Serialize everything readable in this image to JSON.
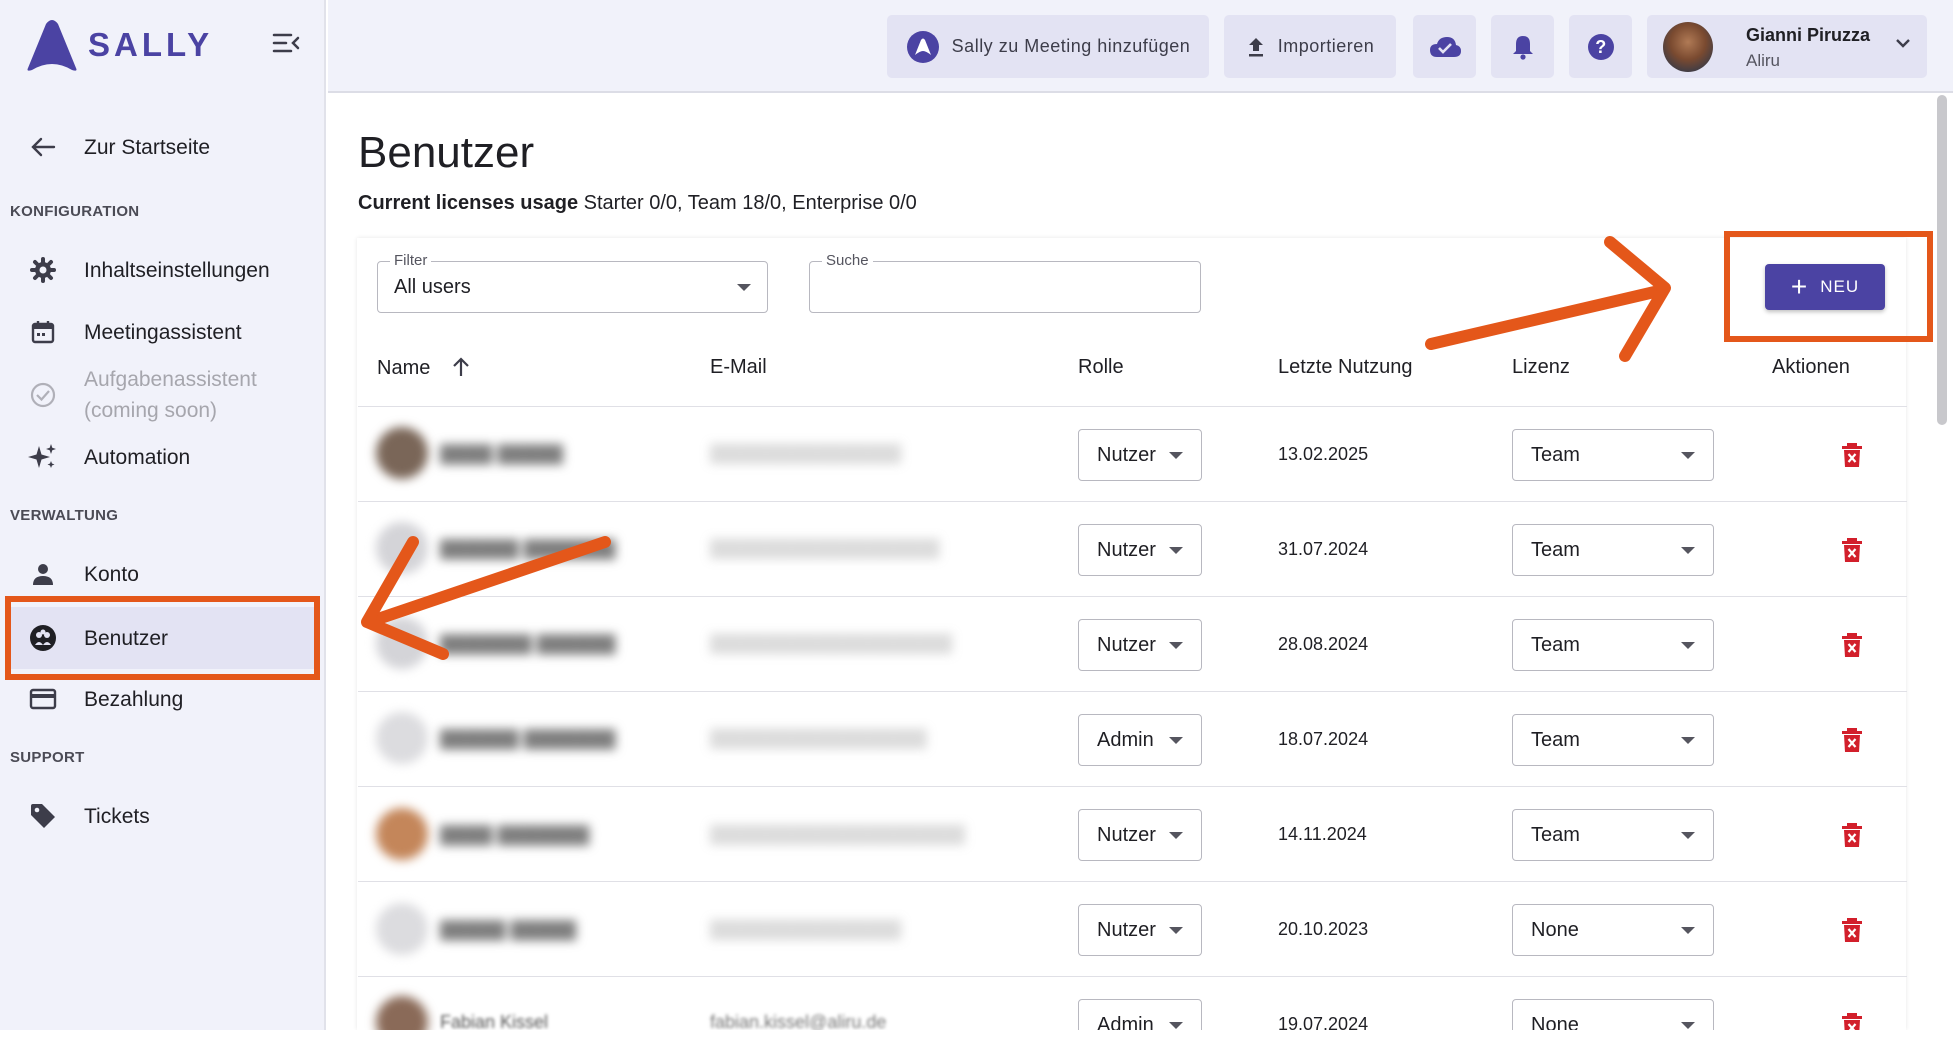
{
  "app": {
    "brand": "SALLY",
    "accent": "#4b43a3",
    "highlight": "#e4571a"
  },
  "sidebar": {
    "back_label": "Zur Startseite",
    "sections": {
      "config": "KONFIGURATION",
      "admin": "VERWALTUNG",
      "support": "SUPPORT"
    },
    "items": {
      "content": "Inhaltseinstellungen",
      "meeting": "Meetingassistent",
      "tasks_line1": "Aufgabenassistent",
      "tasks_line2": "(coming soon)",
      "automation": "Automation",
      "account": "Konto",
      "users": "Benutzer",
      "billing": "Bezahlung",
      "tickets": "Tickets"
    }
  },
  "topbar": {
    "add_meeting": "Sally zu Meeting hinzufügen",
    "import": "Importieren",
    "user_name": "Gianni Piruzza",
    "user_org": "Aliru"
  },
  "main": {
    "title": "Benutzer",
    "license_label": "Current licenses usage",
    "license_value": "Starter 0/0, Team 18/0, Enterprise 0/0",
    "filter_label": "Filter",
    "filter_value": "All users",
    "search_label": "Suche",
    "new_button": "NEU"
  },
  "table": {
    "headers": [
      "Name",
      "E-Mail",
      "Rolle",
      "Letzte Nutzung",
      "Lizenz",
      "Aktionen"
    ],
    "rows": [
      {
        "role": "Nutzer",
        "last_used": "13.02.2025",
        "license": "Team"
      },
      {
        "role": "Nutzer",
        "last_used": "31.07.2024",
        "license": "Team"
      },
      {
        "role": "Nutzer",
        "last_used": "28.08.2024",
        "license": "Team"
      },
      {
        "role": "Admin",
        "last_used": "18.07.2024",
        "license": "Team"
      },
      {
        "role": "Nutzer",
        "last_used": "14.11.2024",
        "license": "Team"
      },
      {
        "role": "Nutzer",
        "last_used": "20.10.2023",
        "license": "None"
      },
      {
        "name": "Fabian Kissel",
        "email": "fabian.kissel@aliru.de",
        "role": "Admin",
        "last_used": "19.07.2024",
        "license": "None"
      }
    ]
  }
}
